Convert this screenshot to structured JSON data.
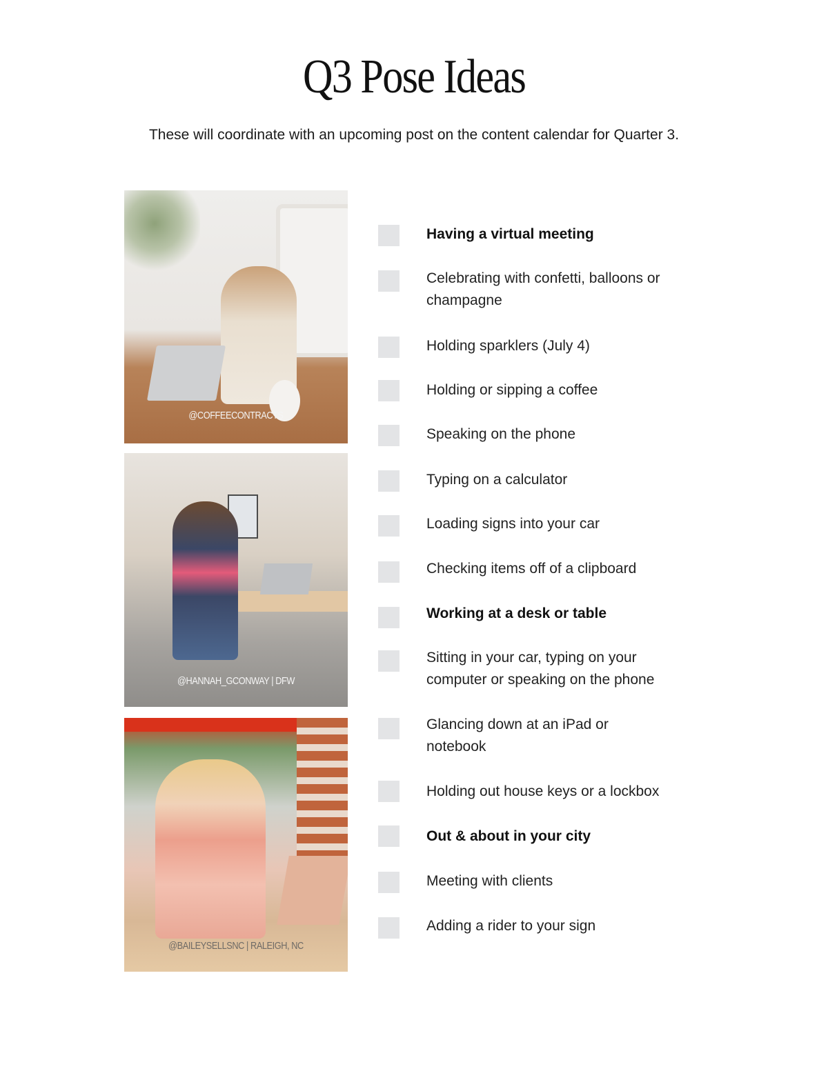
{
  "header": {
    "title": "Q3 Pose Ideas",
    "subtitle": "These will coordinate with an upcoming post on the content calendar for Quarter 3."
  },
  "photos": [
    {
      "caption": "@COFFEECONTRACTS",
      "description": "woman on a video call at a wooden desk with laptop"
    },
    {
      "caption": "@HANNAH_GCONWAY | DFW",
      "description": "woman in plaid blazer seated at table looking at phone"
    },
    {
      "caption": "@BAILEYSELLSNC | RALEIGH, NC",
      "description": "woman in floral dress sipping iced coffee outdoors"
    }
  ],
  "checklist": {
    "items": [
      {
        "label": "Having a virtual meeting",
        "bold": true,
        "checked": false
      },
      {
        "label": "Celebrating with confetti, balloons or champagne",
        "bold": false,
        "checked": false
      },
      {
        "label": "Holding sparklers (July 4)",
        "bold": false,
        "checked": false
      },
      {
        "label": "Holding or sipping a coffee",
        "bold": false,
        "checked": false
      },
      {
        "label": "Speaking on the phone",
        "bold": false,
        "checked": false
      },
      {
        "label": "Typing on a calculator",
        "bold": false,
        "checked": false
      },
      {
        "label": "Loading signs into your car",
        "bold": false,
        "checked": false
      },
      {
        "label": "Checking items off of a clipboard",
        "bold": false,
        "checked": false
      },
      {
        "label": "Working at a desk or table",
        "bold": true,
        "checked": false
      },
      {
        "label": "Sitting in your car, typing on your computer or speaking on the phone",
        "bold": false,
        "checked": false
      },
      {
        "label": "Glancing down at an iPad or notebook",
        "bold": false,
        "checked": false
      },
      {
        "label": "Holding out house keys or a lockbox",
        "bold": false,
        "checked": false
      },
      {
        "label": "Out & about in your city",
        "bold": true,
        "checked": false
      },
      {
        "label": "Meeting with clients",
        "bold": false,
        "checked": false
      },
      {
        "label": "Adding a rider to your sign",
        "bold": false,
        "checked": false
      }
    ]
  },
  "colors": {
    "checkbox": "#e3e4e6",
    "text": "#1a1a1a"
  }
}
